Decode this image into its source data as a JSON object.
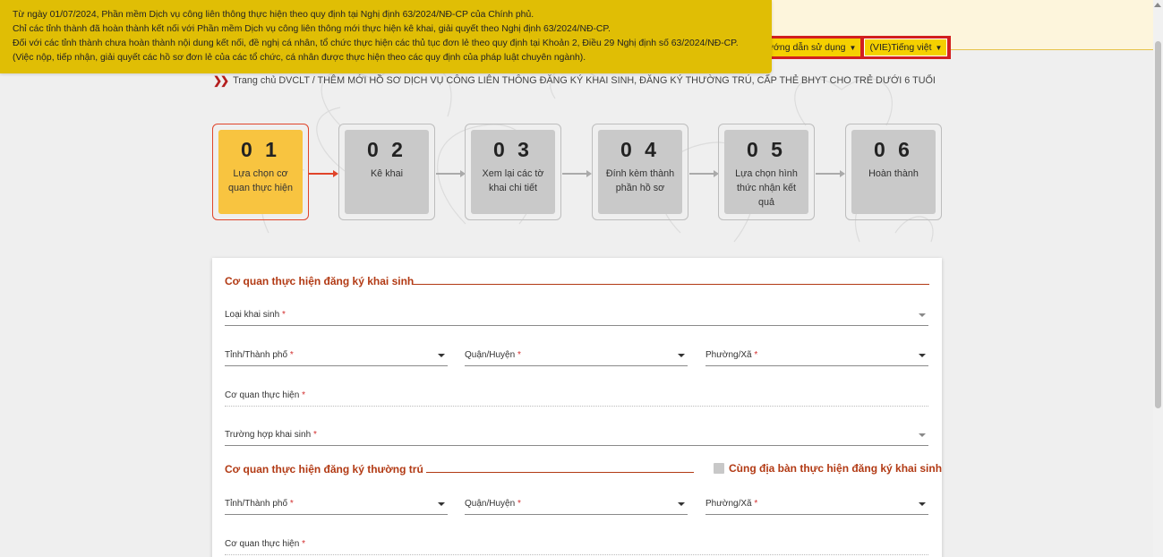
{
  "notice": {
    "lines": [
      "Từ ngày 01/07/2024, Phần mềm Dịch vụ công liên thông thực hiện theo quy định tại Nghị định 63/2024/NĐ-CP của Chính phủ.",
      "Chỉ các tỉnh thành đã hoàn thành kết nối với Phần mềm Dịch vụ công liên thông mới thực hiện kê khai, giải quyết theo Nghị định 63/2024/NĐ-CP.",
      "Đối với các tỉnh thành chưa hoàn thành nội dung kết nối, đề nghị cá nhân, tổ chức thực hiện các thủ tục đơn lẻ theo quy định tại Khoản 2, Điều 29 Nghị định số 63/2024/NĐ-CP.",
      "(Việc nộp, tiếp nhận, giải quyết các hồ sơ đơn lẻ của các tổ chức, cá nhân được thực hiện theo các quy định của pháp luật chuyên ngành)."
    ]
  },
  "header": {
    "guide_label": "ướng dẫn sử dụng",
    "lang_label": "(VIE)Tiếng việt"
  },
  "breadcrumb": {
    "text": "Trang chủ DVCLT / THÊM MỚI HỒ SƠ DỊCH VỤ CÔNG LIÊN THÔNG ĐĂNG KÝ KHAI SINH, ĐĂNG KÝ THƯỜNG TRÚ, CẤP THẺ BHYT CHO TRẺ DƯỚI 6 TUỔI"
  },
  "steps": [
    {
      "num": "0 1",
      "label": "Lựa chọn cơ quan thực hiện",
      "active": true
    },
    {
      "num": "0 2",
      "label": "Kê khai",
      "active": false
    },
    {
      "num": "0 3",
      "label": "Xem lại các tờ khai chi tiết",
      "active": false
    },
    {
      "num": "0 4",
      "label": "Đính kèm thành phần hồ sơ",
      "active": false
    },
    {
      "num": "0 5",
      "label": "Lựa chọn hình thức nhận kết quả",
      "active": false
    },
    {
      "num": "0 6",
      "label": "Hoàn thành",
      "active": false
    }
  ],
  "form": {
    "birth_section": {
      "title": "Cơ quan thực hiện đăng ký khai sinh",
      "birth_type": "Loại khai sinh",
      "province": "Tỉnh/Thành phố",
      "district": "Quận/Huyện",
      "ward": "Phường/Xã",
      "agency": "Cơ quan thực hiện",
      "case": "Trường hợp khai sinh"
    },
    "residence_section": {
      "title": "Cơ quan thực hiện đăng ký thường trú",
      "same_area_label": "Cùng địa bàn thực hiện đăng ký khai sinh",
      "province": "Tỉnh/Thành phố",
      "district": "Quận/Huyện",
      "ward": "Phường/Xã",
      "agency": "Cơ quan thực hiện"
    },
    "required_mark": "*"
  }
}
